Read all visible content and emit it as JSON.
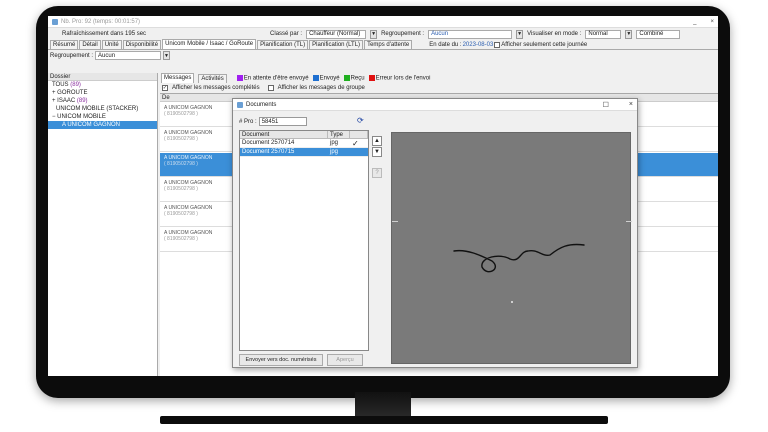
{
  "app": {
    "title": "Nb. Pro: 92 (temps: 00:01:57)",
    "close_glyph": "×",
    "minimize_glyph": "_",
    "refresh_text": "Rafraîchissement dans 195 sec",
    "sort_label": "Classé par :",
    "sort_value": "Chauffeur (Normal)",
    "group_label": "Regroupement :",
    "group_value": "Aucun",
    "view_label": "Visualiser en mode :",
    "view_value": "Normal",
    "combine_value": "Combiné",
    "date_label": "En date du :",
    "date_value": "2023-08-03",
    "today_only_label": "Afficher seulement cette journée"
  },
  "tabs": [
    "Résumé",
    "Détail",
    "Unité",
    "Disponibilité",
    "Unicom Mobile / Isaac / GoRoute",
    "Planification (TL)",
    "Planification (LTL)",
    "Temps d'attente"
  ],
  "grouping": {
    "label": "Regroupement :",
    "value": "Aucun"
  },
  "tree": {
    "header": "Dossier",
    "items": [
      {
        "label": "TOUS",
        "count": "(89)"
      },
      {
        "label": "+ GOROUTE",
        "count": ""
      },
      {
        "label": "+ ISAAC",
        "count": "(89)"
      },
      {
        "label": "UNICOM MOBILE (STACKER)",
        "count": ""
      },
      {
        "label": "− UNICOM MOBILE",
        "count": ""
      },
      {
        "label": "A UNICOM GAGNON",
        "count": ""
      }
    ]
  },
  "subtabs": {
    "messages": "Messages",
    "activities": "Activités"
  },
  "legend": [
    {
      "label": "En attente d'être envoyé",
      "color": "#a020f0"
    },
    {
      "label": "Envoyé",
      "color": "#1e6fd0"
    },
    {
      "label": "Reçu",
      "color": "#20b020"
    },
    {
      "label": "Erreur lors de l'envoi",
      "color": "#e01010"
    }
  ],
  "checks": {
    "completed": "Afficher les messages complétés",
    "group": "Afficher les messages de groupe"
  },
  "messages": {
    "header": "De",
    "rows": [
      {
        "from": "A UNICOM GAGNON",
        "num": "( 8190502798 )"
      },
      {
        "from": "A UNICOM GAGNON",
        "num": "( 8190502798 )"
      },
      {
        "from": "A UNICOM GAGNON",
        "num": "( 8190502798 )"
      },
      {
        "from": "A UNICOM GAGNON",
        "num": "( 8190502798 )"
      },
      {
        "from": "A UNICOM GAGNON",
        "num": "( 8190502798 )"
      },
      {
        "from": "A UNICOM GAGNON",
        "num": "( 8190502798 )"
      }
    ]
  },
  "dialog": {
    "title": "Documents",
    "pro_label": "# Pro :",
    "pro_value": "58451",
    "columns": [
      "Document",
      "Type",
      ""
    ],
    "docs": [
      {
        "name": "Document 2570714",
        "type": "jpg",
        "mark": "✓"
      },
      {
        "name": "Document 2570715",
        "type": "jpg",
        "mark": ""
      }
    ],
    "send_button": "Envoyer vers doc. numérisés",
    "preview_button": "Aperçu",
    "help_glyph": "?",
    "up_glyph": "▲",
    "down_glyph": "▼"
  }
}
